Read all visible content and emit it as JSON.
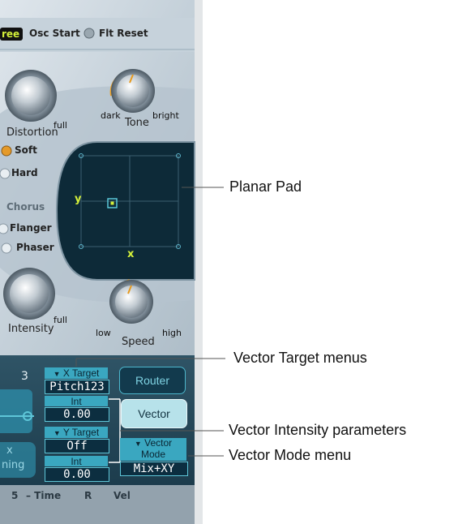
{
  "header": {
    "free_label": "ree",
    "osc_start_label": "Osc Start",
    "flt_reset_label": "Flt Reset"
  },
  "distortion": {
    "label": "Distortion",
    "max_label": "full",
    "soft_label": "Soft",
    "hard_label": "Hard"
  },
  "tone": {
    "label": "Tone",
    "min_label": "dark",
    "max_label": "bright"
  },
  "fx": {
    "chorus_label": "Chorus",
    "flanger_label": "Flanger",
    "phaser_label": "Phaser"
  },
  "pad": {
    "x_label": "x",
    "y_label": "y"
  },
  "intensity": {
    "label": "Intensity",
    "max_label": "full"
  },
  "speed": {
    "label": "Speed",
    "min_label": "low",
    "max_label": "high"
  },
  "bottom": {
    "number_value": "3",
    "x_target_label": "X Target",
    "x_target_value": "Pitch123",
    "x_int_label": "Int",
    "x_int_value": "0.00",
    "y_target_label": "Y Target",
    "y_target_value": "Off",
    "y_int_label": "Int",
    "y_int_value": "0.00",
    "router_label": "Router",
    "vector_label": "Vector",
    "vector_mode_label_1": "Vector",
    "vector_mode_label_2": "Mode",
    "vector_mode_value": "Mix+XY",
    "left_button_label_1": "x",
    "left_button_label_2": "ning",
    "footer_1": "5",
    "footer_2": "– Time",
    "footer_3": "R",
    "footer_4": "Vel"
  },
  "callouts": {
    "planar_pad": "Planar Pad",
    "vector_target_menus": "Vector Target menus",
    "vector_intensity": "Vector Intensity parameters",
    "vector_mode_menu": "Vector Mode menu"
  },
  "colors": {
    "panel": "#c9d4dc",
    "lcd": "#0d2a38",
    "accent": "#e79a1e",
    "highlight": "#d4f03a"
  }
}
